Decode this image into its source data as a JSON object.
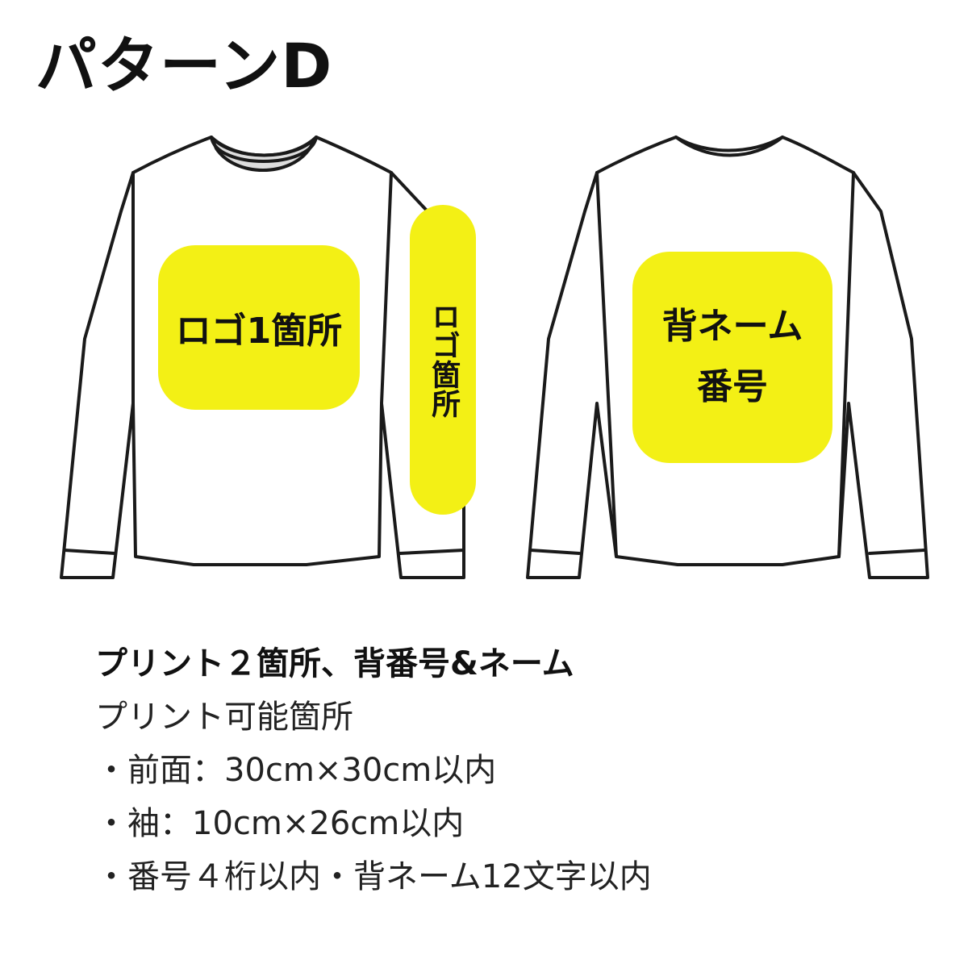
{
  "title": "パターンD",
  "zones": {
    "front": "ロゴ1箇所",
    "sleeve": "ロゴ箇所",
    "back_line1": "背ネーム",
    "back_line2": "番号"
  },
  "description": {
    "headline": "プリント２箇所、背番号&ネーム",
    "subheading": "プリント可能箇所",
    "items": [
      "・前面：30cm×30cm以内",
      "・袖：10cm×26cm以内",
      "・番号４桁以内・背ネーム12文字以内"
    ]
  },
  "colors": {
    "highlight": "#f3f015",
    "outline": "#1a1a1a",
    "collar": "#dddddd"
  }
}
